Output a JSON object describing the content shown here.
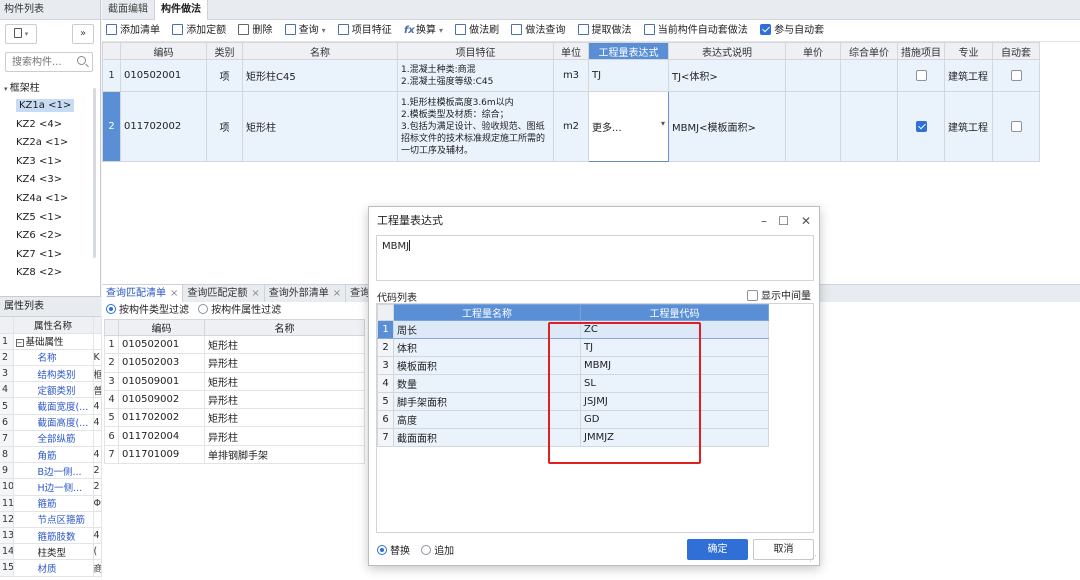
{
  "left": {
    "title": "构件列表",
    "collapse_label": "»",
    "search_placeholder": "搜索构件...",
    "tree_root": "框架柱",
    "tree_items": [
      "KZ1a <1>",
      "KZ2 <4>",
      "KZ2a <1>",
      "KZ3 <1>",
      "KZ4 <3>",
      "KZ4a <1>",
      "KZ5 <1>",
      "KZ6 <2>",
      "KZ7 <1>",
      "KZ8 <2>"
    ],
    "attr_title": "属性列表",
    "attr_header": "属性名称",
    "attr_rows": [
      {
        "n": "1",
        "name": "基础属性",
        "val": "",
        "style": "group"
      },
      {
        "n": "2",
        "name": "名称",
        "val": "K",
        "style": "blue"
      },
      {
        "n": "3",
        "name": "结构类别",
        "val": "框",
        "style": "blue"
      },
      {
        "n": "4",
        "name": "定额类别",
        "val": "普",
        "style": "blue"
      },
      {
        "n": "5",
        "name": "截面宽度(...",
        "val": "4",
        "style": "blue"
      },
      {
        "n": "6",
        "name": "截面高度(...",
        "val": "4",
        "style": "blue"
      },
      {
        "n": "7",
        "name": "全部纵筋",
        "val": "",
        "style": "blue"
      },
      {
        "n": "8",
        "name": "角筋",
        "val": "4",
        "style": "blue"
      },
      {
        "n": "9",
        "name": "B边一侧...",
        "val": "2",
        "style": "blue"
      },
      {
        "n": "10",
        "name": "H边一侧...",
        "val": "2",
        "style": "blue"
      },
      {
        "n": "11",
        "name": "箍筋",
        "val": "Φ",
        "style": "blue"
      },
      {
        "n": "12",
        "name": "节点区箍筋",
        "val": "",
        "style": "blue"
      },
      {
        "n": "13",
        "name": "箍筋肢数",
        "val": "4",
        "style": "blue"
      },
      {
        "n": "14",
        "name": "柱类型",
        "val": "(",
        "style": "plain"
      },
      {
        "n": "15",
        "name": "材质",
        "val": "商",
        "style": "blue"
      }
    ]
  },
  "tabs": [
    "截面编辑",
    "构件做法"
  ],
  "toolbar": {
    "add_list": "添加清单",
    "add_quota": "添加定额",
    "delete": "删除",
    "query": "查询",
    "item_feature": "项目特征",
    "convert": "换算",
    "method_rule": "做法刷",
    "method_query": "做法查询",
    "extract_method": "提取做法",
    "auto_apply_current": "当前构件自动套做法",
    "join_auto": "参与自动套"
  },
  "grid": {
    "headers": [
      "编码",
      "类别",
      "名称",
      "项目特征",
      "单位",
      "工程量表达式",
      "表达式说明",
      "单价",
      "综合单价",
      "措施项目",
      "专业",
      "自动套"
    ],
    "rows": [
      {
        "n": "1",
        "code": "010502001",
        "type": "项",
        "name": "矩形柱C45",
        "feature": "1.混凝土种类:商混\n2.混凝土强度等级:C45",
        "unit": "m3",
        "expr": "TJ",
        "desc": "TJ<体积>",
        "measure": false,
        "major": "建筑工程",
        "auto": false
      },
      {
        "n": "2",
        "code": "011702002",
        "type": "项",
        "name": "矩形柱",
        "feature": "1.矩形柱模板高度3.6m以内\n2.模板类型及材质：综合；\n3.包括为满足设计、验收规范、图纸招标文件的技术标准规定施工所需的一切工序及辅材。",
        "unit": "m2",
        "expr": "更多...",
        "desc": "MBMJ<模板面积>",
        "measure": true,
        "major": "建筑工程",
        "auto": false
      }
    ]
  },
  "lower": {
    "tabs": [
      "查询匹配清单",
      "查询匹配定额",
      "查询外部清单",
      "查询清"
    ],
    "filter_type": "按构件类型过滤",
    "filter_attr": "按构件属性过滤",
    "headers": [
      "编码",
      "名称"
    ],
    "rows": [
      {
        "n": "1",
        "code": "010502001",
        "name": "矩形柱"
      },
      {
        "n": "2",
        "code": "010502003",
        "name": "异形柱"
      },
      {
        "n": "3",
        "code": "010509001",
        "name": "矩形柱"
      },
      {
        "n": "4",
        "code": "010509002",
        "name": "异形柱"
      },
      {
        "n": "5",
        "code": "011702002",
        "name": "矩形柱"
      },
      {
        "n": "6",
        "code": "011702004",
        "name": "异形柱"
      },
      {
        "n": "7",
        "code": "011701009",
        "name": "单排钢脚手架"
      }
    ]
  },
  "dialog": {
    "title": "工程量表达式",
    "expression": "MBMJ",
    "codes_label": "代码列表",
    "show_intermediate": "显示中间量",
    "headers": [
      "工程量名称",
      "工程量代码"
    ],
    "rows": [
      {
        "n": "1",
        "name": "周长",
        "code": "ZC"
      },
      {
        "n": "2",
        "name": "体积",
        "code": "TJ"
      },
      {
        "n": "3",
        "name": "模板面积",
        "code": "MBMJ"
      },
      {
        "n": "4",
        "name": "数量",
        "code": "SL"
      },
      {
        "n": "5",
        "name": "脚手架面积",
        "code": "JSJMJ"
      },
      {
        "n": "6",
        "name": "高度",
        "code": "GD"
      },
      {
        "n": "7",
        "name": "截面面积",
        "code": "JMMJZ"
      }
    ],
    "replace_label": "替换",
    "append_label": "追加",
    "ok_label": "确定",
    "cancel_label": "取消"
  },
  "colors": {
    "accent": "#2f6fd6",
    "header_blue": "#5a8fd6",
    "highlight_box": "#e02020"
  }
}
